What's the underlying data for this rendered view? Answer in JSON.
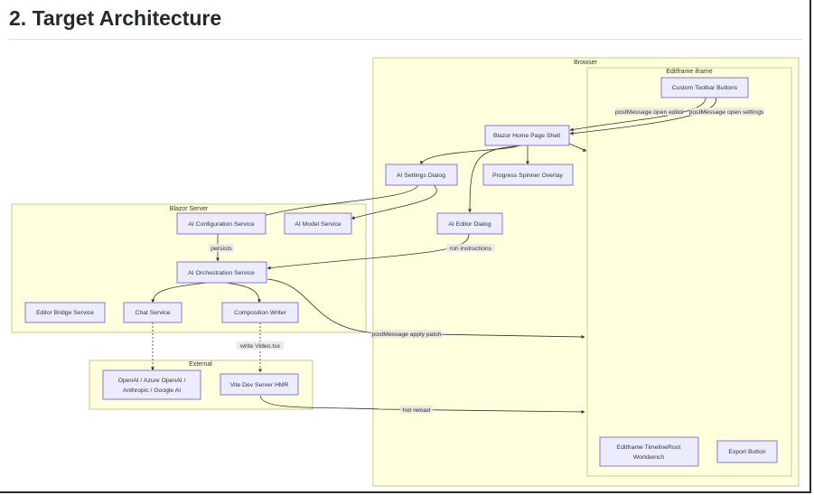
{
  "page": {
    "title": "2. Target Architecture"
  },
  "clusters": {
    "browser": "Browser",
    "editframe_iframe": "Editframe iframe",
    "blazor_server": "Blazor Server",
    "external": "External"
  },
  "nodes": {
    "custom_toolbar_buttons": "Custom Toolbar Buttons",
    "blazor_home_page_shell": "Blazor Home Page Shell",
    "ai_settings_dialog": "AI Settings Dialog",
    "progress_spinner_overlay": "Progress Spinner Overlay",
    "ai_editor_dialog": "AI Editor Dialog",
    "ai_configuration_service": "AI Configuration Service",
    "ai_model_service": "AI Model Service",
    "ai_orchestration_service": "AI Orchestration Service",
    "editor_bridge_service": "Editor Bridge Service",
    "chat_service": "Chat Service",
    "composition_writer": "Composition Writer",
    "openai_line1": "OpenAI / Azure OpenAI /",
    "openai_line2": "Anthropic / Google AI",
    "vite_dev_server_hmr": "Vite Dev Server HMR",
    "timeline_line1": "Editframe TimelineRoot",
    "timeline_line2": "Workbench",
    "export_button": "Export Button"
  },
  "edge_labels": {
    "postmessage_open_editor": "postMessage open editor",
    "postmessage_open_settings": "postMessage open settings",
    "persists": "persists",
    "run_instructions": "run instructions",
    "postmessage_apply_patch": "postMessage apply patch",
    "write_video_tsx": "write Video.tsx",
    "hot_reload": "hot reload"
  },
  "colors": {
    "cluster_fill": "#ffffde",
    "cluster_stroke": "#c9c98a",
    "node_fill": "#ececff",
    "node_stroke": "#9370db",
    "edge": "#333333"
  }
}
